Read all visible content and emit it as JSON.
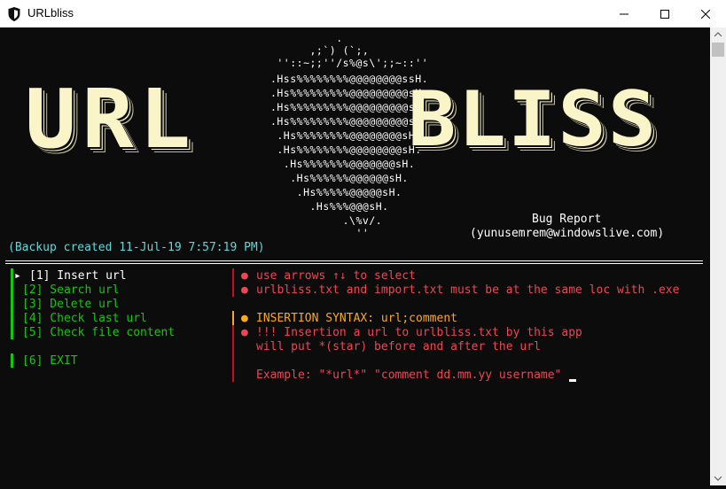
{
  "window": {
    "title": "URLbliss"
  },
  "ascii_art": [
    "                 .",
    "             ,;`) (`;,",
    "        ''::~;;''/s%@s\\';;~::''",
    "       .Hss%%%%%%%%@@@@@@@@ssH.",
    "       .Hs%%%%%%%%%@@@@@@@@@sH.",
    "       .Hs%%%%%%%%%@@@@@@@@@sH.",
    "       .Hs%%%%%%%%%@@@@@@@@@sH.",
    "        .Hs%%%%%%%%@@@@@@@@sH.",
    "        .Hs%%%%%%%%@@@@@@@@sH.",
    "         .Hs%%%%%%%@@@@@@@sH.",
    "          .Hs%%%%%%@@@@@@sH.",
    "           .Hs%%%%%@@@@@sH.",
    "             .Hs%%%@@@sH.",
    "               .Hs%%@@sH.",
    "                  .\\%v/.",
    "                    ''"
  ],
  "banner": {
    "left_word": "URL",
    "right_word": "BLISS"
  },
  "bug_report": {
    "label": "Bug Report",
    "email": "(yunusemrem@windowslive.com)"
  },
  "backup_status": "(Backup created 11-Jul-19 7:57:19 PM)",
  "menu": {
    "pointer": "▸",
    "items": [
      {
        "label": "[1] Insert url"
      },
      {
        "label": "[2] Search url"
      },
      {
        "label": "[3] Delete url"
      },
      {
        "label": "[4] Check last url"
      },
      {
        "label": "[5] Check file content"
      },
      {
        "label": "[6] EXIT"
      }
    ]
  },
  "info": {
    "bullet": "●",
    "line1": "use arrows ↑↓ to select",
    "line2": "urlbliss.txt and import.txt must be at the same loc with .exe",
    "syntax": "INSERTION SYNTAX: url;comment",
    "warn1": "!!! Insertion a url to urlbliss.txt by this app",
    "warn2": "will put *(star) before and after the url",
    "example": "Example: \"*url*\" \"comment dd.mm.yy username\""
  },
  "colors": {
    "background": "#0c0c0c",
    "banner": "#faf5c8",
    "menu_green": "#16c60c",
    "info_red": "#e74856",
    "syntax_orange": "#f9a825",
    "backup_cyan": "#61d6d6"
  },
  "icons": [
    "shield-icon",
    "minimize-icon",
    "maximize-icon",
    "close-icon",
    "scroll-up-icon",
    "scroll-down-icon"
  ]
}
